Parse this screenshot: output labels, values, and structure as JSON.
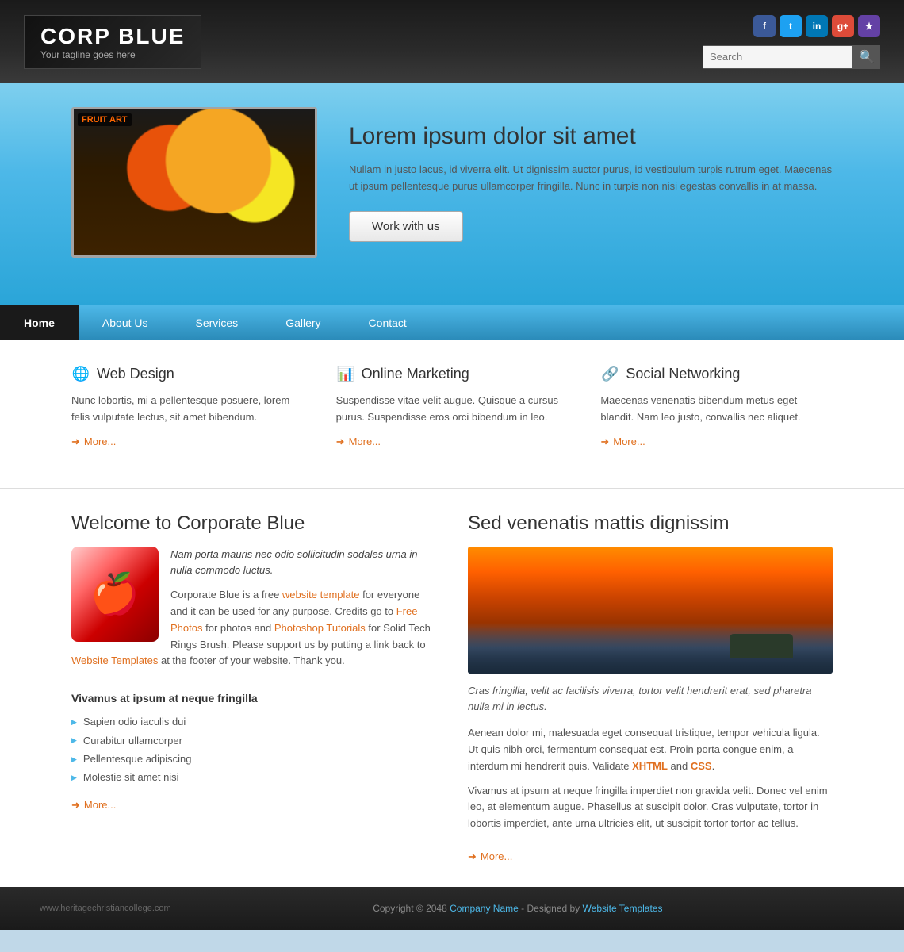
{
  "header": {
    "logo_title": "CORP BLUE",
    "logo_tagline": "Your tagline goes here",
    "search_placeholder": "Search",
    "search_button_icon": "🔍",
    "social_icons": [
      {
        "name": "facebook",
        "label": "f",
        "class": "si-fb"
      },
      {
        "name": "twitter",
        "label": "t",
        "class": "si-tw"
      },
      {
        "name": "linkedin",
        "label": "in",
        "class": "si-li"
      },
      {
        "name": "google",
        "label": "g",
        "class": "si-gg"
      },
      {
        "name": "other",
        "label": "★",
        "class": "si-ot"
      }
    ]
  },
  "hero": {
    "title": "Lorem ipsum dolor sit amet",
    "body": "Nullam in justo lacus, id viverra elit. Ut dignissim auctor purus, id vestibulum turpis rutrum eget. Maecenas ut ipsum pellentesque purus ullamcorper fringilla. Nunc in turpis non nisi egestas convallis in at massa.",
    "cta_label": "Work with us"
  },
  "nav": {
    "items": [
      {
        "label": "Home",
        "active": true
      },
      {
        "label": "About Us",
        "active": false
      },
      {
        "label": "Services",
        "active": false
      },
      {
        "label": "Gallery",
        "active": false
      },
      {
        "label": "Contact",
        "active": false
      }
    ]
  },
  "services": {
    "items": [
      {
        "icon": "🌐",
        "title": "Web Design",
        "body": "Nunc lobortis, mi a pellentesque posuere, lorem felis vulputate lectus, sit amet bibendum.",
        "more_label": "More..."
      },
      {
        "icon": "📊",
        "title": "Online Marketing",
        "body": "Suspendisse vitae velit augue. Quisque a cursus purus. Suspendisse eros orci bibendum in leo.",
        "more_label": "More..."
      },
      {
        "icon": "🔗",
        "title": "Social Networking",
        "body": "Maecenas venenatis bibendum metus eget blandit. Nam leo justo, convallis nec aliquet.",
        "more_label": "More..."
      }
    ]
  },
  "main_left": {
    "title": "Welcome to Corporate Blue",
    "italic_text": "Nam porta mauris nec odio sollicitudin sodales urna in nulla commodo luctus.",
    "para1_pre": "Corporate Blue is a free ",
    "para1_link1": "website template",
    "para1_link1_url": "#",
    "para1_mid": " for everyone and it can be used for any purpose. Credits go to ",
    "para1_link2": "Free Photos",
    "para1_link2_url": "#",
    "para1_mid2": " for photos and ",
    "para1_link3": "Photoshop Tutorials",
    "para1_link3_url": "#",
    "para1_end": " for Solid Tech Rings Brush. Please support us by putting a link back to ",
    "para1_link4": "Website Templates",
    "para1_link4_url": "#",
    "para1_tail": " at the footer of your website. Thank you.",
    "sub_title": "Vivamus at ipsum at neque fringilla",
    "bullets": [
      "Sapien odio iaculis dui",
      "Curabitur ullamcorper",
      "Pellentesque adipiscing",
      "Molestie sit amet nisi"
    ],
    "more_label": "More..."
  },
  "main_right": {
    "title": "Sed venenatis mattis dignissim",
    "italic_caption": "Cras fringilla, velit ac facilisis viverra, tortor velit hendrerit erat, sed pharetra nulla mi in lectus.",
    "para1": "Aenean dolor mi, malesuada eget consequat tristique, tempor vehicula ligula. Ut quis nibh orci, fermentum consequat est. Proin porta congue enim, a interdum mi hendrerit quis. Validate ",
    "xhtml_label": "XHTML",
    "and_text": " and ",
    "css_label": "CSS",
    "period": ".",
    "para2": "Vivamus at ipsum at neque fringilla imperdiet non gravida velit. Donec vel enim leo, at elementum augue. Phasellus at suscipit dolor. Cras vulputate, tortor in lobortis imperdiet, ante urna ultricies elit, ut suscipit tortor tortor ac tellus.",
    "more_label": "More..."
  },
  "footer": {
    "left_text": "www.heritagechristiancollege.com",
    "copyright_pre": "Copyright © 2048 ",
    "company_name": "Company Name",
    "by_text": " - Designed by ",
    "designer_name": "Website Templates"
  }
}
